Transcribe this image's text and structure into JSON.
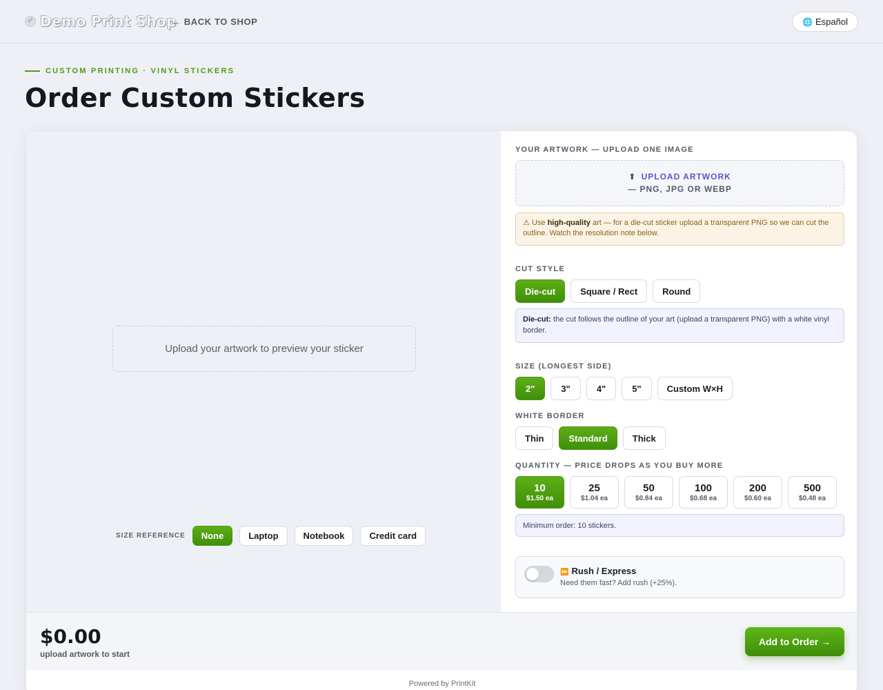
{
  "header": {
    "logo_text": "Demo Print Shop",
    "back_label": "← BACK TO SHOP",
    "language_label": "Español",
    "language_icon": "globe-icon"
  },
  "hero": {
    "eyebrow": "CUSTOM PRINTING · VINYL STICKERS",
    "title": "Order Custom Stickers"
  },
  "preview": {
    "placeholder": "Upload your artwork to preview your sticker",
    "size_reference_label": "SIZE REFERENCE",
    "size_reference_options": [
      "None",
      "Laptop",
      "Notebook",
      "Credit card"
    ],
    "size_reference_selected": "None"
  },
  "artwork": {
    "label": "YOUR ARTWORK — UPLOAD ONE IMAGE",
    "upload_icon": "⬆",
    "upload_label": "UPLOAD ARTWORK",
    "upload_formats": "— PNG, JPG OR WEBP",
    "warning_icon": "⚠",
    "warning_prefix": "Use",
    "warning_bold": "high-quality",
    "warning_rest": "art — for a die-cut sticker upload a transparent PNG so we can cut the outline. Watch the resolution note below."
  },
  "cut_style": {
    "label": "CUT STYLE",
    "options": [
      "Die-cut",
      "Square / Rect",
      "Round"
    ],
    "selected": "Die-cut",
    "info_bold": "Die-cut:",
    "info_rest": "the cut follows the outline of your art (upload a transparent PNG) with a white vinyl border."
  },
  "size": {
    "label": "SIZE (LONGEST SIDE)",
    "options": [
      "2\"",
      "3\"",
      "4\"",
      "5\"",
      "Custom W×H"
    ],
    "selected": "2\""
  },
  "border": {
    "label": "WHITE BORDER",
    "options": [
      "Thin",
      "Standard",
      "Thick"
    ],
    "selected": "Standard"
  },
  "quantity": {
    "label": "QUANTITY — PRICE DROPS AS YOU BUY MORE",
    "options": [
      {
        "qty": "10",
        "price": "$1.50 ea"
      },
      {
        "qty": "25",
        "price": "$1.04 ea"
      },
      {
        "qty": "50",
        "price": "$0.84 ea"
      },
      {
        "qty": "100",
        "price": "$0.68 ea"
      },
      {
        "qty": "200",
        "price": "$0.60 ea"
      },
      {
        "qty": "500",
        "price": "$0.48 ea"
      }
    ],
    "selected": "10",
    "minimum_note": "Minimum order: 10 stickers."
  },
  "rush": {
    "icon": "⏩",
    "title": "Rush / Express",
    "subtitle": "Need them fast? Add rush (+25%).",
    "enabled": false
  },
  "footer": {
    "price": "$0.00",
    "note": "upload artwork to start",
    "add_button": "Add to Order →"
  },
  "powered_by": "Powered by PrintKit",
  "colors": {
    "accent_green": "#4f9a12",
    "link_purple": "#5a56c8",
    "warning_bg": "#faf3e6",
    "info_bg": "#f1f2fd"
  }
}
